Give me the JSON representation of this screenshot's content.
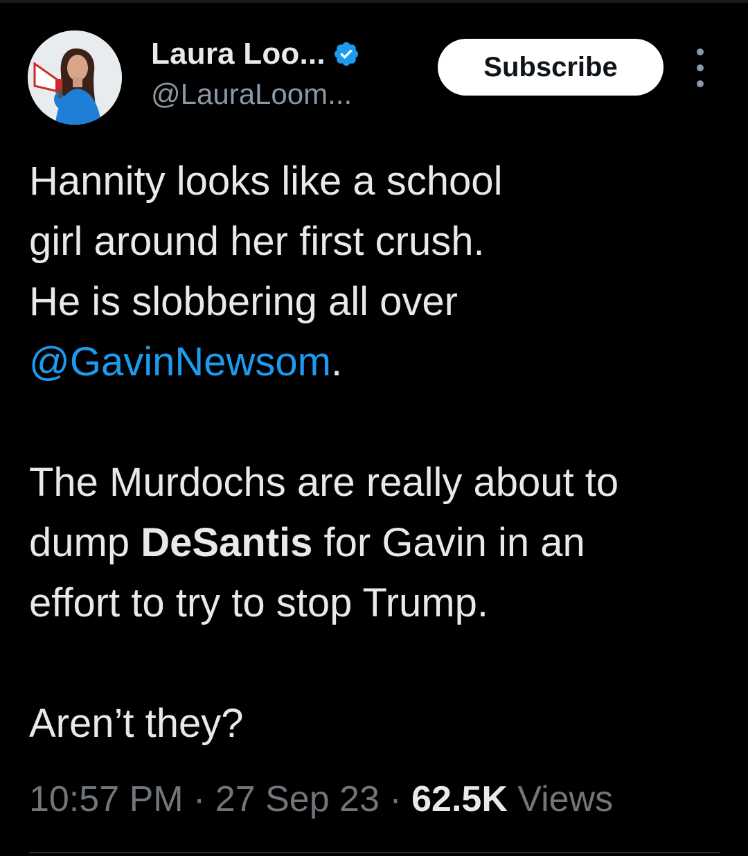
{
  "author": {
    "display_name": "Laura Loo...",
    "handle": "@LauraLoom...",
    "verified": true,
    "avatar_icon": "profile-photo-with-megaphone"
  },
  "actions": {
    "subscribe_label": "Subscribe",
    "more_icon": "vertical-ellipsis-icon"
  },
  "tweet": {
    "para1": {
      "line1": "Hannity looks like a school",
      "line2": "girl around her first crush.",
      "line3": "He is slobbering all over",
      "mention": "@GavinNewsom",
      "after_mention": "."
    },
    "para2": {
      "before_bold": "The Murdochs are really about to dump ",
      "bold": "DeSantis",
      "after_bold": " for Gavin in an effort to try to stop Trump."
    },
    "para3": "Aren’t they?"
  },
  "meta": {
    "time": "10:57 PM",
    "separator1": " · ",
    "date": "27 Sep 23",
    "separator2": " · ",
    "views_count": "62.5K",
    "views_label": " Views"
  },
  "colors": {
    "background": "#000000",
    "text": "#e7e9ea",
    "secondary_text": "#71767b",
    "link": "#1d9bf0",
    "verified_badge": "#1d9bf0",
    "button_bg": "#ffffff"
  }
}
